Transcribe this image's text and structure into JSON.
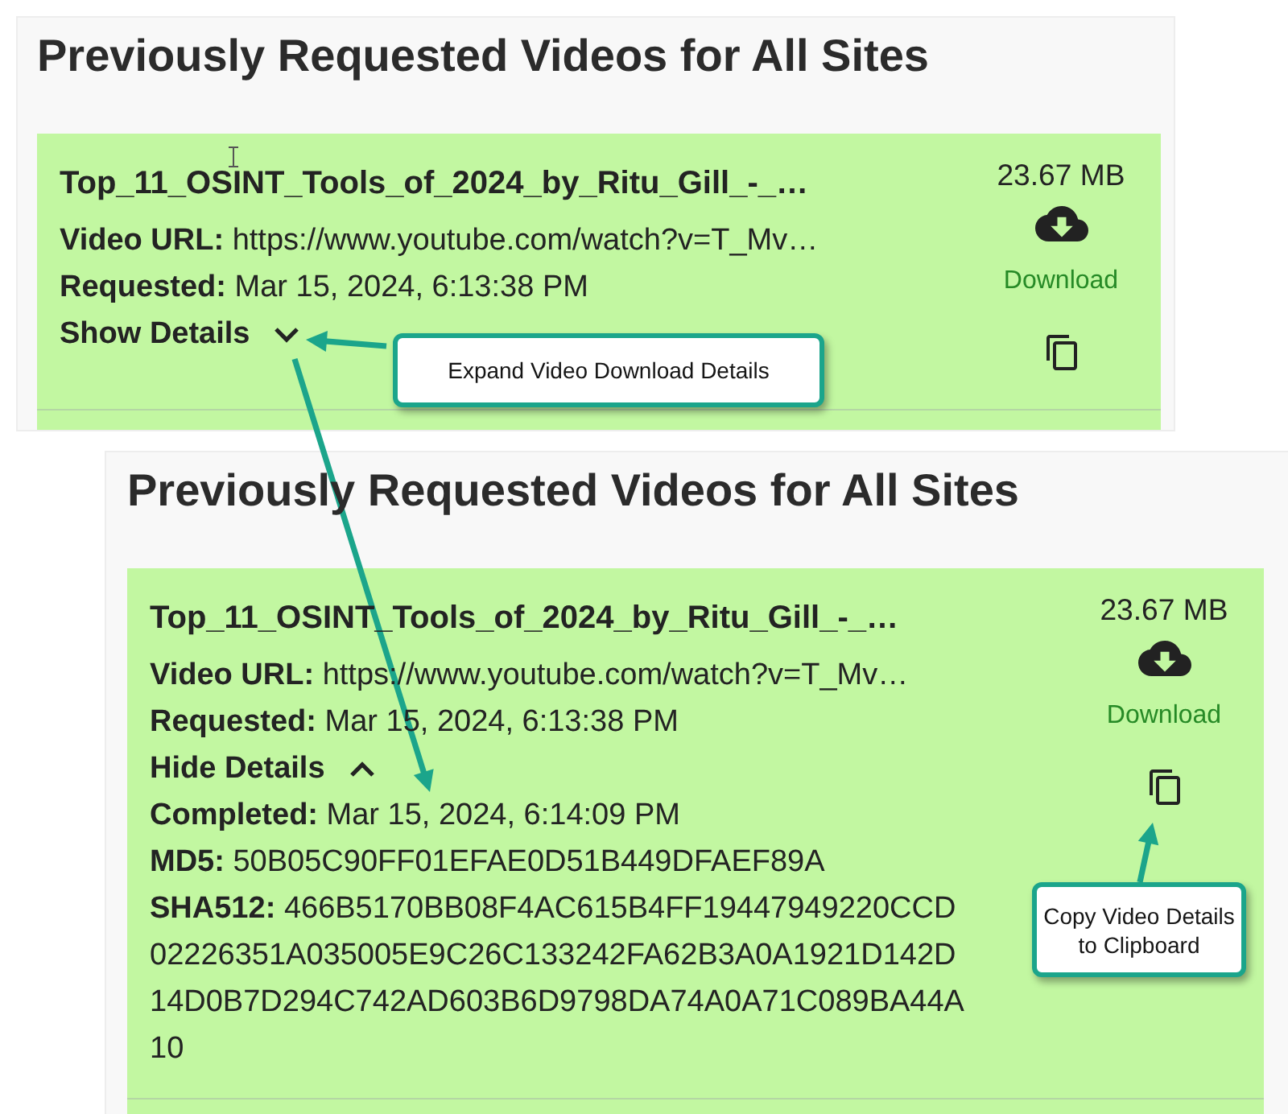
{
  "panels": [
    {
      "title": "Previously Requested Videos for All Sites",
      "videos": [
        {
          "filename": "Top_11_OSINT_Tools_of_2024_by_Ritu_Gill_-_…",
          "fields": [
            {
              "label": "Video URL:",
              "value": "https://www.youtube.com/watch?v=T_Mv…"
            },
            {
              "label": "Requested:",
              "value": "Mar 15, 2024, 6:13:38 PM"
            }
          ],
          "toggle": {
            "label": "Show Details",
            "expanded": false
          },
          "size": "23.67 MB",
          "download": "Download"
        }
      ]
    },
    {
      "title": "Previously Requested Videos for All Sites",
      "videos": [
        {
          "filename": "Top_11_OSINT_Tools_of_2024_by_Ritu_Gill_-_…",
          "fields": [
            {
              "label": "Video URL:",
              "value": "https://www.youtube.com/watch?v=T_Mv…"
            },
            {
              "label": "Requested:",
              "value": "Mar 15, 2024, 6:13:38 PM"
            }
          ],
          "toggle": {
            "label": "Hide Details",
            "expanded": true
          },
          "details": [
            {
              "label": "Completed:",
              "value": "Mar 15, 2024, 6:14:09 PM"
            },
            {
              "label": "MD5:",
              "value": "50B05C90FF01EFAE0D51B449DFAEF89A"
            },
            {
              "label": "SHA512:",
              "value": "466B5170BB08F4AC615B4FF19447949220CCD02226351A035005E9C26C133242FA62B3A0A1921D142D14D0B7D294C742AD603B6D9798DA74A0A71C089BA44A10"
            }
          ],
          "size": "23.67 MB",
          "download": "Download"
        }
      ]
    }
  ],
  "callouts": [
    {
      "text": "Expand Video Download Details"
    },
    {
      "text": "Copy Video Details to Clipboard"
    }
  ]
}
